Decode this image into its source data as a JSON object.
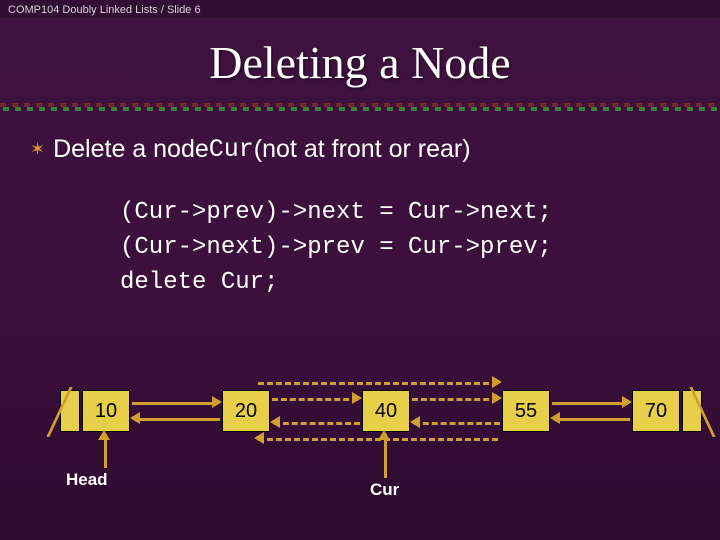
{
  "header": {
    "text": "COMP104 Doubly Linked Lists / Slide 6"
  },
  "title": "Deleting a Node",
  "bullet": {
    "pre": "Delete a node ",
    "mono": "Cur",
    "post": " (not at front or rear)"
  },
  "code": {
    "line1": "(Cur->prev)->next = Cur->next;",
    "line2": "(Cur->next)->prev = Cur->prev;",
    "line3": "delete Cur;"
  },
  "nodes": {
    "n1": "10",
    "n2": "20",
    "n3": "40",
    "n4": "55",
    "n5": "70"
  },
  "labels": {
    "head": "Head",
    "cur": "Cur"
  }
}
